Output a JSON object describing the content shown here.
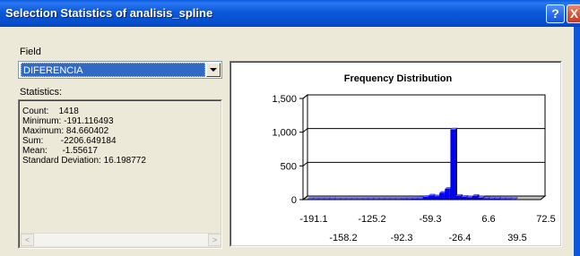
{
  "window": {
    "title": "Selection Statistics of analisis_spline",
    "help_label": "?",
    "close_label": "X"
  },
  "field": {
    "label": "Field",
    "selected": "DIFERENCIA"
  },
  "statistics": {
    "label": "Statistics:",
    "lines": [
      "Count:    1418",
      "Minimum: -191.116493",
      "Maximum: 84.660402",
      "Sum:       -2206.649184",
      "Mean:      -1.55617",
      "Standard Deviation: 16.198772"
    ]
  },
  "chart_data": {
    "type": "bar",
    "title": "Frequency Distribution",
    "xlabel": "",
    "ylabel": "",
    "ylim": [
      0,
      1500
    ],
    "yticks": [
      "1,500",
      "1,000",
      "500",
      "0"
    ],
    "ytick_values": [
      1500,
      1000,
      500,
      0
    ],
    "xticks_upper": [
      "-191.1",
      "-125.2",
      "-59.3",
      "6.6",
      "72.5"
    ],
    "xticks_lower": [
      "-158.2",
      "-92.3",
      "-26.4",
      "39.5"
    ],
    "bar_color": "#0000ff",
    "values": [
      10,
      10,
      10,
      10,
      10,
      8,
      8,
      8,
      8,
      8,
      10,
      10,
      10,
      10,
      10,
      10,
      10,
      12,
      12,
      14,
      16,
      40,
      60,
      48,
      100,
      160,
      1040,
      55,
      40,
      35,
      55,
      30,
      18,
      15,
      15,
      12,
      12,
      10
    ]
  }
}
